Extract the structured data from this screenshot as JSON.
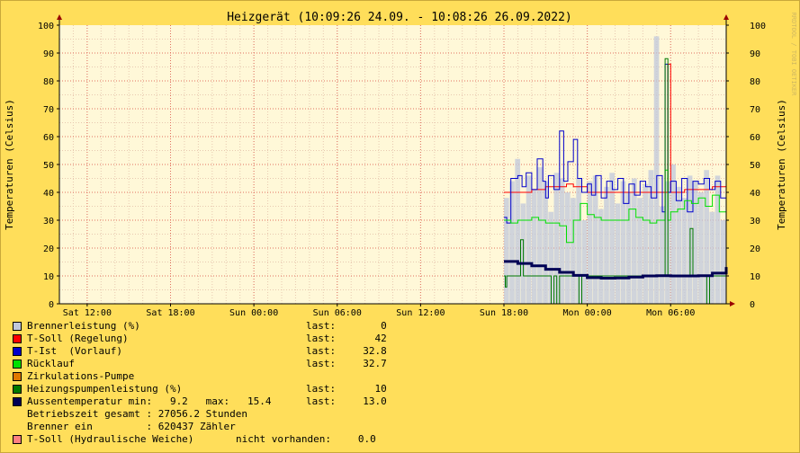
{
  "chart_data": {
    "type": "line",
    "title": "Heizgerät (10:09:26 24.09. - 10:08:26 26.09.2022)",
    "ylabel": "Temperaturen (Celsius)",
    "ylabel_right": "Temperaturen (Celsius)",
    "watermark": "RRDTOOL / TOBI OETIKER",
    "ylim": [
      0,
      100
    ],
    "yticks": [
      "0",
      "10",
      "20",
      "30",
      "40",
      "50",
      "60",
      "70",
      "80",
      "90",
      "100"
    ],
    "x_start": "24.09. 10:09",
    "x_ticks": [
      "Sat 12:00",
      "Sat 18:00",
      "Sun 00:00",
      "Sun 06:00",
      "Sun 12:00",
      "Sun 18:00",
      "Mon 00:00",
      "Mon 06:00"
    ],
    "x_tick_hours": [
      2,
      8,
      14,
      20,
      26,
      32,
      38,
      44
    ],
    "x_range_hours": [
      0,
      48
    ],
    "grid": true,
    "series": [
      {
        "name": "Brennerleistung (%)",
        "color": "#C0C8DC",
        "style": "bars",
        "x": [
          32.0,
          32.4,
          32.8,
          33.2,
          33.6,
          34.0,
          34.4,
          34.8,
          35.2,
          35.6,
          36.0,
          36.4,
          36.8,
          37.2,
          37.6,
          38.0,
          38.4,
          38.8,
          39.2,
          39.6,
          40.0,
          40.4,
          40.8,
          41.2,
          41.6,
          42.0,
          42.4,
          42.8,
          43.2,
          43.6,
          44.0,
          44.4,
          44.8,
          45.2,
          45.6,
          46.0,
          46.4,
          46.8,
          47.2,
          47.6,
          48.0
        ],
        "y": [
          38,
          44,
          52,
          36,
          46,
          41,
          49,
          44,
          33,
          47,
          45,
          40,
          38,
          45,
          30,
          44,
          46,
          34,
          42,
          47,
          36,
          44,
          40,
          45,
          38,
          43,
          48,
          96,
          35,
          44,
          50,
          42,
          38,
          46,
          44,
          40,
          48,
          33,
          46,
          30,
          0
        ]
      },
      {
        "name": "T-Soll (Regelung)",
        "color": "#FF0000",
        "style": "line",
        "x": [
          32.0,
          33.0,
          34.0,
          35.0,
          36.0,
          36.5,
          37.0,
          38.0,
          39.0,
          40.0,
          41.0,
          42.0,
          43.0,
          43.6,
          43.8,
          44.0,
          45.0,
          46.0,
          47.0,
          48.0
        ],
        "y": [
          40,
          40,
          41,
          42,
          42,
          43,
          42,
          40,
          40,
          40,
          40,
          40,
          40,
          40,
          86,
          40,
          41,
          41,
          42,
          42
        ]
      },
      {
        "name": "T-Ist  (Vorlauf)",
        "color": "#0000CC",
        "style": "line",
        "x": [
          32.0,
          32.2,
          32.5,
          33.0,
          33.3,
          33.6,
          34.0,
          34.4,
          34.8,
          35.0,
          35.2,
          35.6,
          36.0,
          36.3,
          36.6,
          37.0,
          37.3,
          37.6,
          38.0,
          38.3,
          38.6,
          39.0,
          39.4,
          39.8,
          40.2,
          40.6,
          41.0,
          41.4,
          41.8,
          42.2,
          42.6,
          43.0,
          43.4,
          43.6,
          43.8,
          44.0,
          44.4,
          44.8,
          45.2,
          45.6,
          46.0,
          46.4,
          46.8,
          47.2,
          47.6,
          48.0
        ],
        "y": [
          31,
          29,
          45,
          46,
          42,
          47,
          41,
          52,
          44,
          38,
          46,
          41,
          62,
          44,
          51,
          59,
          45,
          40,
          43,
          39,
          46,
          38,
          44,
          41,
          45,
          36,
          43,
          39,
          44,
          42,
          38,
          46,
          33,
          86,
          40,
          44,
          37,
          45,
          33,
          44,
          43,
          45,
          41,
          44,
          38,
          33
        ]
      },
      {
        "name": "Rücklauf",
        "color": "#00E000",
        "style": "line",
        "x": [
          32.0,
          32.5,
          33.0,
          33.5,
          34.0,
          34.5,
          35.0,
          35.5,
          36.0,
          36.5,
          37.0,
          37.5,
          38.0,
          38.5,
          39.0,
          39.5,
          40.0,
          40.5,
          41.0,
          41.5,
          42.0,
          42.5,
          43.0,
          43.4,
          43.6,
          43.8,
          44.0,
          44.5,
          45.0,
          45.5,
          46.0,
          46.5,
          47.0,
          47.5,
          48.0
        ],
        "y": [
          30,
          29,
          30,
          30,
          31,
          30,
          29,
          29,
          28,
          22,
          30,
          36,
          32,
          31,
          30,
          30,
          30,
          30,
          34,
          31,
          30,
          29,
          30,
          30,
          48,
          30,
          33,
          34,
          37,
          36,
          38,
          35,
          39,
          33,
          33
        ]
      },
      {
        "name": "Zirkulations-Pumpe",
        "color": "#E07800",
        "style": "line",
        "x": [],
        "y": []
      },
      {
        "name": "Heizungspumpenleistung (%)",
        "color": "#007800",
        "style": "line",
        "x": [
          32.0,
          32.1,
          32.2,
          33.0,
          33.2,
          33.4,
          33.6,
          34.0,
          35.0,
          35.4,
          35.6,
          35.8,
          36.0,
          37.0,
          37.4,
          37.6,
          37.8,
          38.0,
          39.0,
          40.0,
          41.0,
          42.0,
          43.0,
          43.4,
          43.6,
          43.8,
          44.0,
          45.0,
          45.4,
          45.6,
          45.8,
          46.0,
          46.6,
          46.8,
          47.0,
          48.0
        ],
        "y": [
          10,
          6,
          10,
          10,
          23,
          10,
          10,
          10,
          10,
          0,
          10,
          0,
          10,
          10,
          0,
          10,
          10,
          10,
          10,
          10,
          10,
          10,
          10,
          10,
          88,
          10,
          10,
          10,
          27,
          10,
          10,
          10,
          0,
          10,
          10,
          10
        ]
      },
      {
        "name": "Aussentemperatur",
        "color": "#000055",
        "style": "thick",
        "x": [
          32.0,
          33.0,
          34.0,
          35.0,
          36.0,
          37.0,
          38.0,
          39.0,
          40.0,
          41.0,
          42.0,
          43.0,
          44.0,
          45.0,
          46.0,
          47.0,
          48.0
        ],
        "y": [
          15.2,
          14.5,
          13.6,
          12.4,
          11.3,
          10.2,
          9.4,
          9.2,
          9.3,
          9.6,
          10.0,
          10.1,
          10.0,
          10.0,
          10.1,
          11.0,
          13.2
        ]
      }
    ]
  },
  "legend": [
    {
      "name": "Brennerleistung (%)",
      "color": "#C0C8DC",
      "stat": "last:",
      "value": "0"
    },
    {
      "name": "T-Soll (Regelung)",
      "color": "#FF0000",
      "stat": "last:",
      "value": "42"
    },
    {
      "name": "T-Ist  (Vorlauf)",
      "color": "#0000CC",
      "stat": "last:",
      "value": "32.8"
    },
    {
      "name": "Rücklauf",
      "color": "#00E000",
      "stat": "last:",
      "value": "32.7"
    },
    {
      "name": "Zirkulations-Pumpe",
      "color": "#E07800",
      "stat": "",
      "value": ""
    },
    {
      "name": "Heizungspumpenleistung (%)",
      "color": "#007800",
      "stat": "last:",
      "value": "10"
    },
    {
      "name": "Aussentemperatur min:   9.2   max:   15.4",
      "color": "#000055",
      "stat": "last:",
      "value": "13.0"
    }
  ],
  "info": {
    "betriebszeit": "Betriebszeit gesamt : 27056.2 Stunden",
    "brenner": "Brenner ein         : 620437 Zähler"
  },
  "hydraulic": {
    "name": "T-Soll (Hydraulische Weiche)",
    "color": "#FF8080",
    "status": "nicht vorhanden:",
    "value": "0.0"
  }
}
